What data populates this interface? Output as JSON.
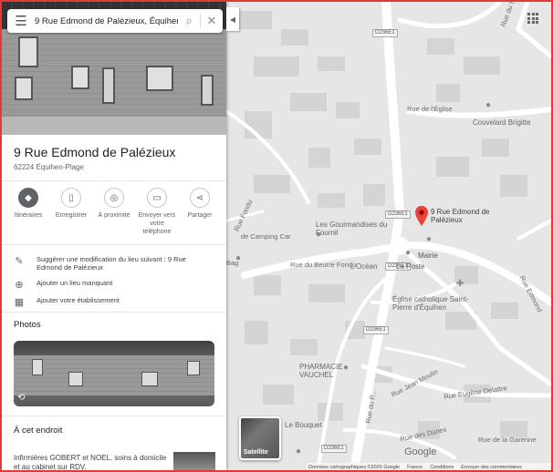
{
  "search": {
    "query": "9 Rue Edmond de Palézieux, Équihen-Plage"
  },
  "place": {
    "title": "9 Rue Edmond de Palézieux",
    "subtitle": "62224 Équihen-Plage"
  },
  "actions": [
    {
      "label": "Itinéraires",
      "icon": "directions-icon"
    },
    {
      "label": "Enregistrer",
      "icon": "bookmark-icon"
    },
    {
      "label": "À proximité",
      "icon": "nearby-icon"
    },
    {
      "label": "Envoyer vers votre téléphone",
      "icon": "send-to-phone-icon"
    },
    {
      "label": "Partager",
      "icon": "share-icon"
    }
  ],
  "options": [
    {
      "label": "Suggérer une modification du lieu suivant : 9 Rue Edmond de Palézieux",
      "icon": "pencil-icon"
    },
    {
      "label": "Ajouter un lieu manquant",
      "icon": "add-location-icon"
    },
    {
      "label": "Ajouter votre établissement",
      "icon": "add-business-icon"
    }
  ],
  "photos_heading": "Photos",
  "here_heading": "À cet endroit",
  "business": {
    "text": "Infirmières GOBERT et NOEL, soins à domicile et au cabinet sur RDV."
  },
  "map": {
    "pin_label": "9 Rue Edmond de Palézieux",
    "labels": {
      "rue_eglise": "Rue de l'Église",
      "couvelard": "Couvelard Brigitte",
      "gourmandises": "Les Gourmandises du Fournil",
      "mairie": "Mairie",
      "la_poste": "La Poste",
      "camping": "de Camping Car",
      "rue_beurre": "Rue du Beurre Fondu",
      "locean": "L'Océan",
      "eglise": "Église catholique Saint-Pierre d'Équihen",
      "pharmacie": "PHARMACIE VAUCHEL",
      "rue_jean_moulin": "Rue Jean Moulin",
      "rue_eugene": "Rue Eugène Delattre",
      "le_bouquet": "Le Bouquet",
      "rue_edmond_side": "Rue Edmond",
      "rue_sud": "Rue du Sud",
      "rue_fondu": "Rue Fondu",
      "bag": "Bag",
      "rue_du_ple": "Rue du P...",
      "rue_dunes": "Rue des Dunes",
      "rue_garenne": "Rue de la Garenne"
    },
    "road_tags": {
      "d236e1": "D236E1"
    },
    "satellite_label": "Satellite",
    "google_logo": "Google",
    "footer": [
      "Données cartographiques ©2020 Google",
      "France",
      "Conditions",
      "Envoyer des commentaires"
    ]
  }
}
